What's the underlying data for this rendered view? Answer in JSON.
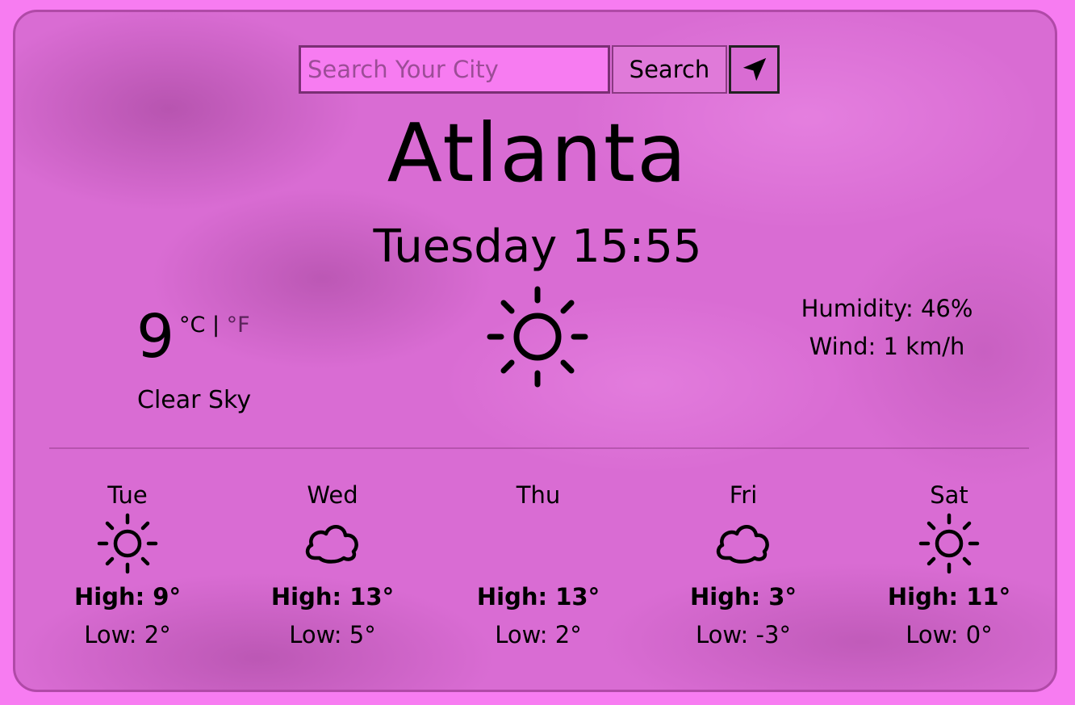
{
  "search": {
    "placeholder": "Search Your City",
    "value": "",
    "button_label": "Search",
    "location_icon": "location-arrow-icon"
  },
  "current": {
    "city": "Atlanta",
    "datetime": "Tuesday 15:55",
    "temperature": "9",
    "unit_c": "°C",
    "unit_separator": "|",
    "unit_f": "°F",
    "condition": "Clear Sky",
    "icon": "sun-icon",
    "humidity": "Humidity: 46%",
    "wind": "Wind: 1 km/h"
  },
  "forecast": [
    {
      "day": "Tue",
      "icon": "sun-icon",
      "high": "High: 9°",
      "low": "Low: 2°"
    },
    {
      "day": "Wed",
      "icon": "cloud-icon",
      "high": "High: 13°",
      "low": "Low: 5°"
    },
    {
      "day": "Thu",
      "icon": "none",
      "high": "High: 13°",
      "low": "Low: 2°"
    },
    {
      "day": "Fri",
      "icon": "cloud-icon",
      "high": "High: 3°",
      "low": "Low: -3°"
    },
    {
      "day": "Sat",
      "icon": "sun-icon",
      "high": "High: 11°",
      "low": "Low: 0°"
    }
  ],
  "colors": {
    "page_background": "#f77cf1",
    "card_background": "#d96cd3",
    "input_background": "#f77cf1",
    "text": "#000000"
  }
}
